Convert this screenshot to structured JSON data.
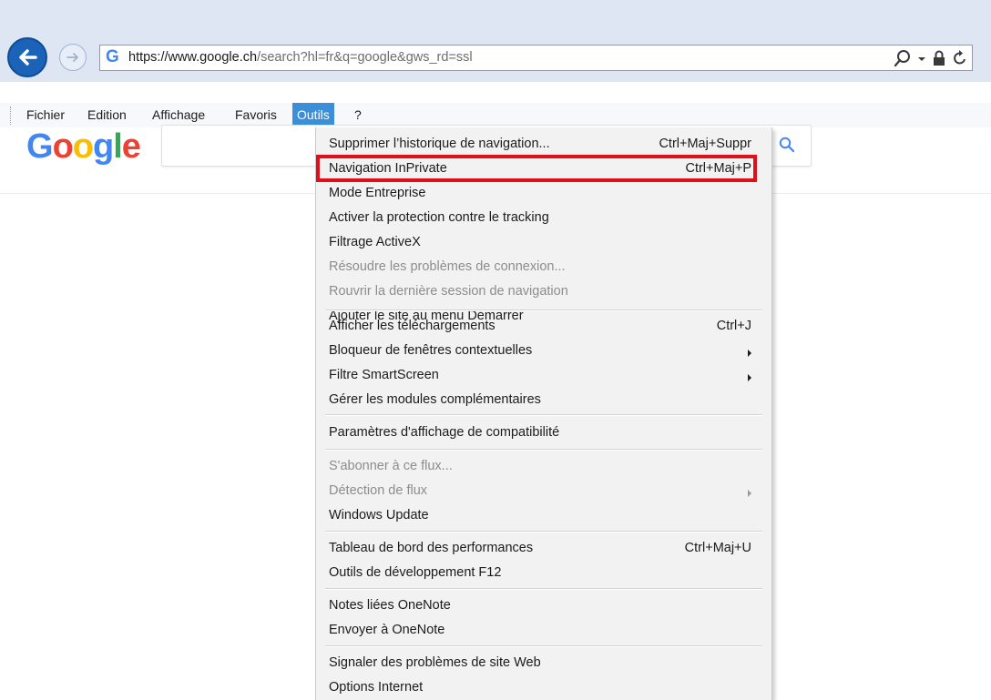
{
  "browser": {
    "url_host": "https://www.google.ch",
    "url_path": "/search?hl=fr&q=google&gws_rd=ssl",
    "favicon_letter": "G",
    "icons": [
      "back-arrow-icon",
      "forward-arrow-icon",
      "search-icon",
      "dropdown-arrow-icon",
      "lock-icon",
      "refresh-icon"
    ]
  },
  "menubar": {
    "items": [
      "Fichier",
      "Edition",
      "Affichage",
      "Favoris",
      "Outils",
      "?"
    ],
    "active": "Outils"
  },
  "google": {
    "logo": [
      "G",
      "o",
      "o",
      "g",
      "l",
      "e"
    ],
    "logo_colors": [
      "#4285f4",
      "#ea4335",
      "#fbbc05",
      "#4285f4",
      "#34a853",
      "#ea4335"
    ]
  },
  "tools_menu": {
    "highlight_color": "#e0101a",
    "items": [
      {
        "label": "Supprimer l’historique de navigation...",
        "shortcut": "Ctrl+Maj+Suppr"
      },
      {
        "label": "Navigation InPrivate",
        "shortcut": "Ctrl+Maj+P",
        "highlighted": true
      },
      {
        "label": "Mode Entreprise"
      },
      {
        "label": "Activer la protection contre le tracking"
      },
      {
        "label": "Filtrage ActiveX"
      },
      {
        "label": "Résoudre les problèmes de connexion...",
        "disabled": true
      },
      {
        "label": "Rouvrir la dernière session de navigation",
        "disabled": true
      },
      {
        "label": "Ajouter le site au menu Démarrer"
      },
      {
        "label": "Afficher les téléchargements",
        "shortcut": "Ctrl+J"
      },
      {
        "label": "Bloqueur de fenêtres contextuelles",
        "submenu": true
      },
      {
        "label": "Filtre SmartScreen",
        "submenu": true
      },
      {
        "label": "Gérer les modules complémentaires"
      },
      {
        "label": "Paramètres d'affichage de compatibilité"
      },
      {
        "label": "S'abonner à ce flux...",
        "disabled": true
      },
      {
        "label": "Détection de flux",
        "disabled": true,
        "submenu": true
      },
      {
        "label": "Windows Update"
      },
      {
        "label": "Tableau de bord des performances",
        "shortcut": "Ctrl+Maj+U"
      },
      {
        "label": "Outils de développement F12"
      },
      {
        "label": "Notes liées OneNote"
      },
      {
        "label": "Envoyer à OneNote"
      },
      {
        "label": "Signaler des problèmes de site Web"
      },
      {
        "label": "Options Internet"
      }
    ]
  }
}
